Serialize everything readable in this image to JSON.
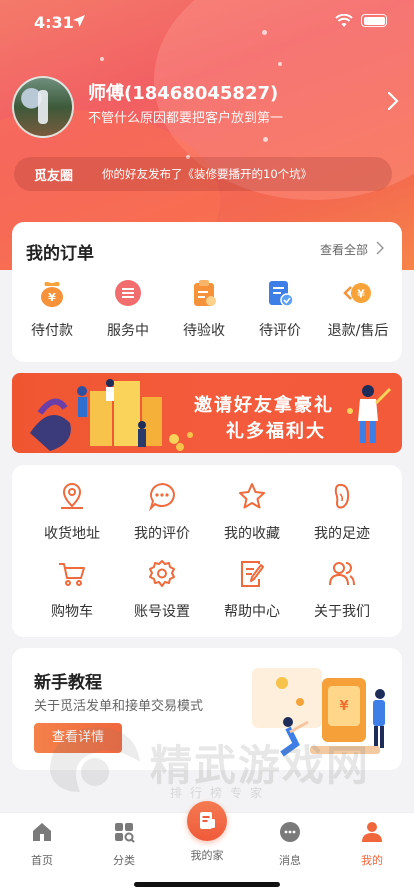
{
  "status_bar": {
    "time": "4:31"
  },
  "profile": {
    "name": "师傅(18468045827)",
    "motto": "不管什么原因都要把客户放到第一"
  },
  "friend_feed": {
    "tag": "觅友圈",
    "text": "你的好友发布了《装修要播开的10个坑》"
  },
  "orders": {
    "title": "我的订单",
    "view_all": "查看全部",
    "items": [
      {
        "label": "待付款",
        "icon": "wallet-icon"
      },
      {
        "label": "服务中",
        "icon": "service-icon"
      },
      {
        "label": "待验收",
        "icon": "clipboard-icon"
      },
      {
        "label": "待评价",
        "icon": "review-icon"
      },
      {
        "label": "退款/售后",
        "icon": "refund-icon"
      }
    ]
  },
  "banner": {
    "line1": "邀请好友拿豪礼",
    "line2": "礼多福利大"
  },
  "services": {
    "items": [
      {
        "label": "收货地址",
        "icon": "location-icon"
      },
      {
        "label": "我的评价",
        "icon": "chat-icon"
      },
      {
        "label": "我的收藏",
        "icon": "star-icon"
      },
      {
        "label": "我的足迹",
        "icon": "footprint-icon"
      },
      {
        "label": "购物车",
        "icon": "cart-icon"
      },
      {
        "label": "账号设置",
        "icon": "gear-icon"
      },
      {
        "label": "帮助中心",
        "icon": "help-doc-icon"
      },
      {
        "label": "关于我们",
        "icon": "users-icon"
      }
    ]
  },
  "tutorial": {
    "title": "新手教程",
    "subtitle": "关于觅活发单和接单交易模式",
    "button": "查看详情"
  },
  "watermark": {
    "title": "精武游戏网",
    "subtitle": "排行榜专家"
  },
  "tabbar": {
    "tabs": [
      {
        "label": "首页",
        "icon": "home-icon"
      },
      {
        "label": "分类",
        "icon": "grid-icon"
      },
      {
        "label": "我的家",
        "icon": "house-doc-icon"
      },
      {
        "label": "消息",
        "icon": "message-icon"
      },
      {
        "label": "我的",
        "icon": "profile-icon"
      }
    ],
    "active_index": 4
  },
  "colors": {
    "accent": "#f0673e",
    "header_gradient_start": "#f47a6a",
    "header_gradient_end": "#f6844a"
  }
}
